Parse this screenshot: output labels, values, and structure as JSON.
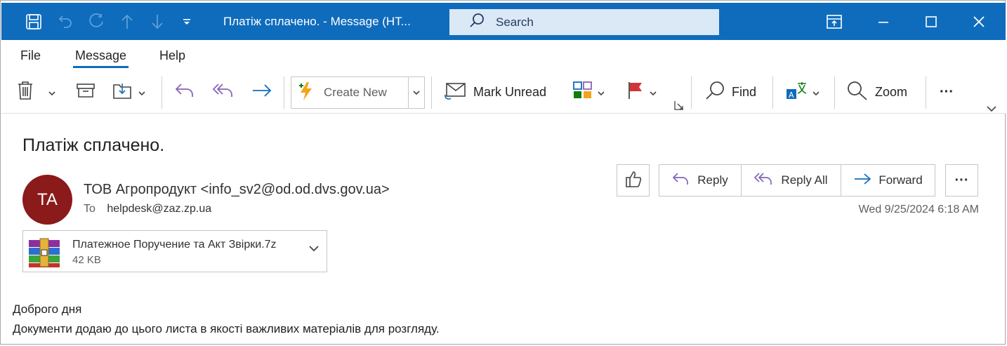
{
  "window": {
    "title": "Платіж сплачено.  -  Message (HT...",
    "search_placeholder": "Search"
  },
  "menu": {
    "tabs": [
      "File",
      "Message",
      "Help"
    ],
    "active": "Message"
  },
  "ribbon": {
    "create_new": "Create New",
    "mark_unread": "Mark Unread",
    "find": "Find",
    "zoom": "Zoom",
    "more": "···"
  },
  "message": {
    "subject": "Платіж сплачено.",
    "avatar_initials": "TA",
    "sender": "ТОВ Агропродукт <info_sv2@od.od.dvs.gov.ua>",
    "to_label": "To",
    "to": "helpdesk@zaz.zp.ua",
    "date": "Wed 9/25/2024 6:18 AM",
    "actions": {
      "reply": "Reply",
      "reply_all": "Reply All",
      "forward": "Forward",
      "more": "···"
    },
    "attachment": {
      "name": "Платежное Поручение та Акт Звірки.7z",
      "size": "42 KB"
    },
    "body": [
      "Доброго дня",
      "Документи додаю до цього листа в якості важливих матеріалів для розгляду."
    ]
  },
  "colors": {
    "titlebar": "#0f6cbd",
    "avatar": "#8b1a1a",
    "flag": "#d13438",
    "accent": "#0f6cbd"
  },
  "icons": [
    "save-icon",
    "undo-icon",
    "redo-icon",
    "up-icon",
    "down-icon",
    "customize-icon",
    "search-icon",
    "ribbon-display-icon",
    "minimize-icon",
    "maximize-icon",
    "close-icon",
    "delete-icon",
    "archive-icon",
    "move-icon",
    "reply-icon",
    "reply-all-icon",
    "forward-icon",
    "lightning-icon",
    "mail-icon",
    "categorize-icon",
    "flag-icon",
    "dialog-launcher-icon",
    "translate-icon",
    "zoom-icon",
    "thumbs-up-icon",
    "archive-file-icon"
  ]
}
